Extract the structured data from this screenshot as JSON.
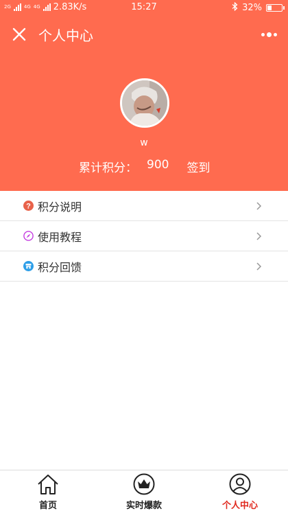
{
  "status_bar": {
    "net_a": "2G",
    "net_b": "4G",
    "net_c": "4G",
    "speed": "2.83K/s",
    "time": "15:27",
    "battery": "32%",
    "battery_level": 0.32,
    "bluetooth_icon": "bluetooth-icon"
  },
  "header": {
    "title": "个人中心",
    "close_icon": "close-icon",
    "more_icon": "more-icon",
    "bg_color": "#ff6b4f"
  },
  "profile": {
    "username": "w",
    "points_label": "累计积分：",
    "points_value": "900",
    "sign_label": "签到"
  },
  "menu": {
    "items": [
      {
        "label": "积分说明",
        "icon": "question-icon",
        "color": "#e8624a"
      },
      {
        "label": "使用教程",
        "icon": "compass-icon",
        "color": "#c43ce0"
      },
      {
        "label": "积分回馈",
        "icon": "store-icon",
        "color": "#2d9ee8"
      }
    ]
  },
  "tabbar": {
    "tabs": [
      {
        "label": "首页",
        "icon": "home-icon"
      },
      {
        "label": "实时爆款",
        "icon": "crown-icon"
      },
      {
        "label": "个人中心",
        "icon": "user-icon",
        "active": true
      }
    ],
    "active_color": "#e0281d"
  }
}
